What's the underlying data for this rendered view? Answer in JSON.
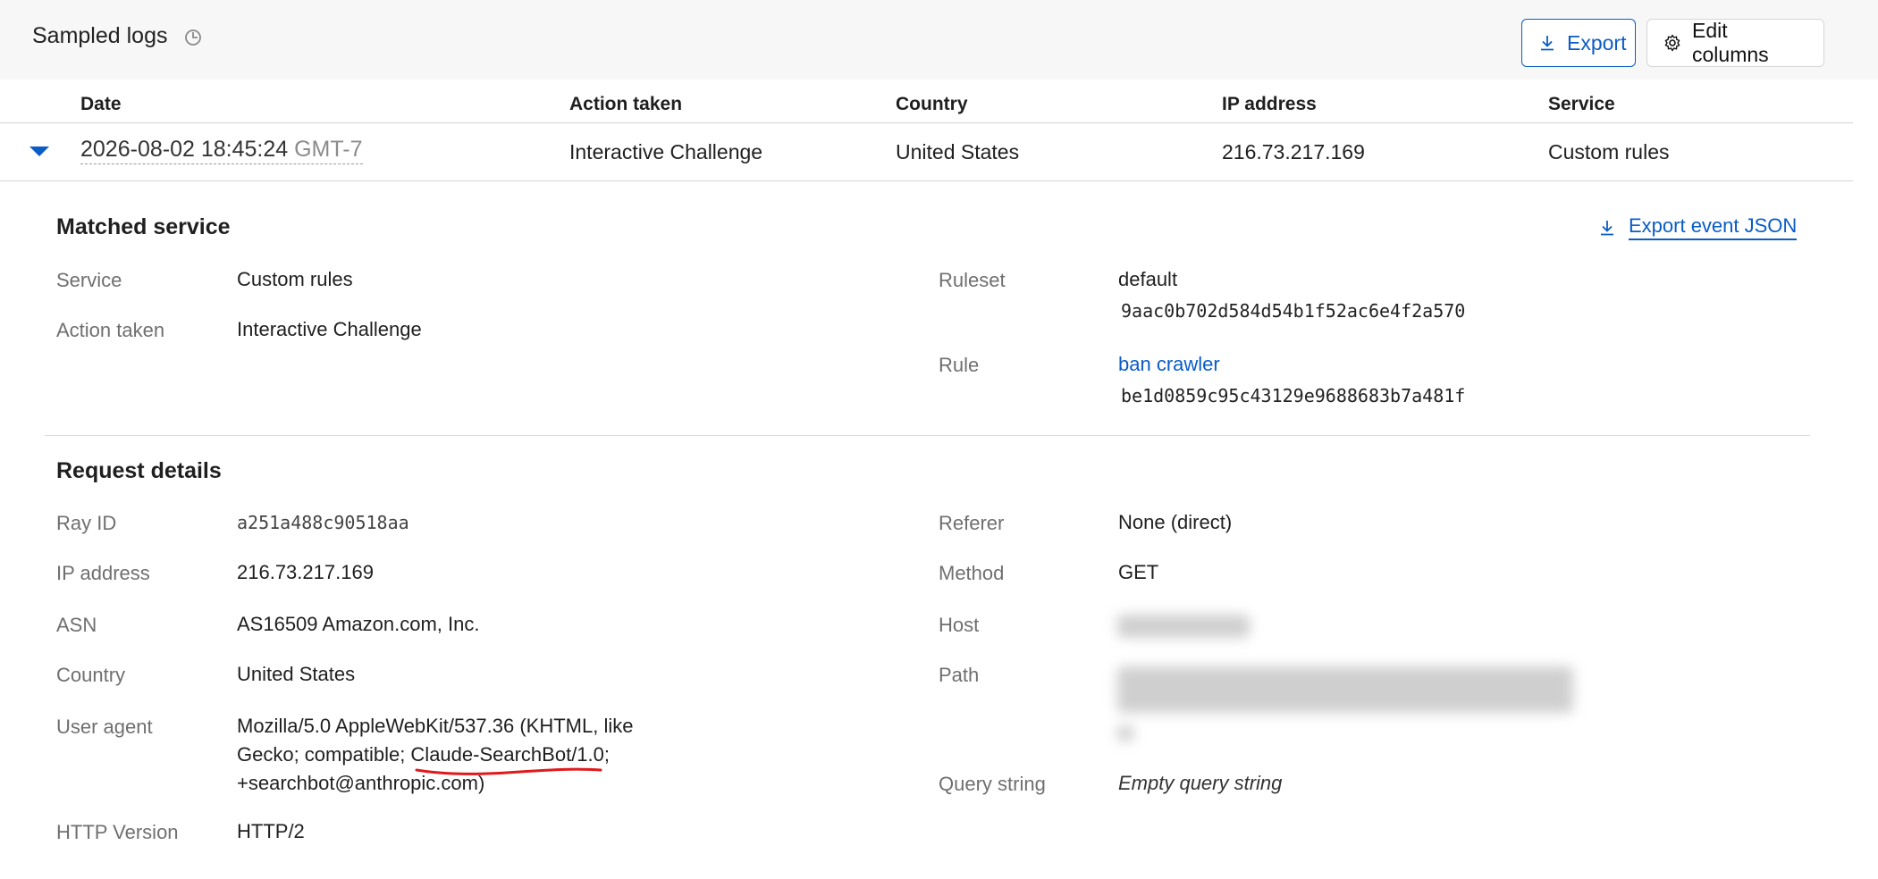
{
  "header": {
    "title": "Sampled logs",
    "history_icon": "history-clock-icon",
    "export_label": "Export",
    "export_icon": "download-icon",
    "edit_columns_label": "Edit columns",
    "edit_columns_icon": "gear-icon"
  },
  "table": {
    "columns": [
      "Date",
      "Action taken",
      "Country",
      "IP address",
      "Service"
    ],
    "row": {
      "date": "2026-08-02 18:45:24",
      "timezone": "GMT-7",
      "action": "Interactive Challenge",
      "country": "United States",
      "ip": "216.73.217.169",
      "service": "Custom rules"
    }
  },
  "matched_service": {
    "title": "Matched service",
    "export_json_label": "Export event JSON",
    "service_label": "Service",
    "service_value": "Custom rules",
    "action_label": "Action taken",
    "action_value": "Interactive Challenge",
    "ruleset_label": "Ruleset",
    "ruleset_name": "default",
    "ruleset_id": "9aac0b702d584d54b1f52ac6e4f2a570",
    "rule_label": "Rule",
    "rule_name": "ban crawler",
    "rule_id": "be1d0859c95c43129e9688683b7a481f"
  },
  "request_details": {
    "title": "Request details",
    "ray_id_label": "Ray ID",
    "ray_id_value": "a251a488c90518aa",
    "ip_label": "IP address",
    "ip_value": "216.73.217.169",
    "asn_label": "ASN",
    "asn_value": "AS16509 Amazon.com, Inc.",
    "country_label": "Country",
    "country_value": "United States",
    "ua_label": "User agent",
    "ua_line1": "Mozilla/5.0 AppleWebKit/537.36 (KHTML, like",
    "ua_line2": "Gecko; compatible; Claude-SearchBot/1.0;",
    "ua_line3": "+searchbot@anthropic.com)",
    "http_label": "HTTP Version",
    "http_value": "HTTP/2",
    "referer_label": "Referer",
    "referer_value": "None (direct)",
    "method_label": "Method",
    "method_value": "GET",
    "host_label": "Host",
    "path_label": "Path",
    "query_label": "Query string",
    "query_value": "Empty query string"
  },
  "colors": {
    "accent": "#0a5cc7",
    "annotation": "#e0191b"
  }
}
